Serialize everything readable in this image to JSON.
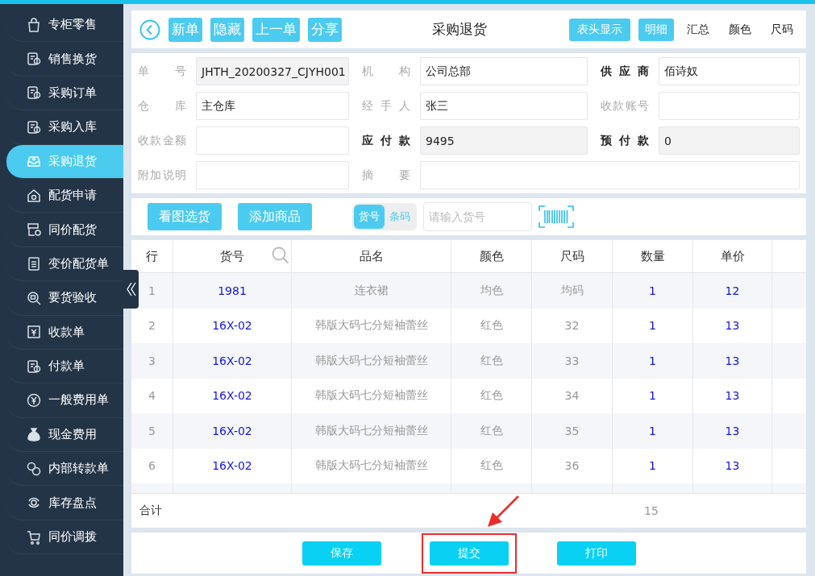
{
  "sidebar": {
    "items": [
      {
        "label": "专柜零售",
        "selected": false
      },
      {
        "label": "销售换货",
        "selected": false
      },
      {
        "label": "采购订单",
        "selected": false
      },
      {
        "label": "采购入库",
        "selected": false
      },
      {
        "label": "采购退货",
        "selected": true
      },
      {
        "label": "配货申请",
        "selected": false
      },
      {
        "label": "同价配货",
        "selected": false
      },
      {
        "label": "变价配货单",
        "selected": false
      },
      {
        "label": "要货验收",
        "selected": false
      },
      {
        "label": "收款单",
        "selected": false
      },
      {
        "label": "付款单",
        "selected": false
      },
      {
        "label": "一般费用单",
        "selected": false
      },
      {
        "label": "现金费用",
        "selected": false
      },
      {
        "label": "内部转款单",
        "selected": false
      },
      {
        "label": "库存盘点",
        "selected": false
      },
      {
        "label": "同价调拨",
        "selected": false
      }
    ]
  },
  "header": {
    "title": "采购退货",
    "actions": [
      "新单",
      "隐藏",
      "上一单",
      "分享"
    ],
    "header_button": "表头显示",
    "views": [
      {
        "label": "明细",
        "selected": true
      },
      {
        "label": "汇总",
        "selected": false
      },
      {
        "label": "颜色",
        "selected": false
      },
      {
        "label": "尺码",
        "selected": false
      }
    ]
  },
  "form": {
    "fields": [
      {
        "label": "单号",
        "value": "JHTH_20200327_CJYH001",
        "bold": false,
        "readonly": true,
        "wide": false
      },
      {
        "label": "机构",
        "value": "公司总部",
        "bold": false,
        "readonly": false,
        "wide": false
      },
      {
        "label": "供应商",
        "value": "佰诗奴",
        "bold": true,
        "readonly": false,
        "wide": false
      },
      {
        "label": "仓库",
        "value": "主仓库",
        "bold": false,
        "readonly": false,
        "wide": false
      },
      {
        "label": "经手人",
        "value": "张三",
        "bold": false,
        "readonly": false,
        "wide": false
      },
      {
        "label": "收款账号",
        "bold": false,
        "readonly": false,
        "wide": false
      },
      {
        "label": "收款金额",
        "bold": false,
        "readonly": false,
        "wide": false
      },
      {
        "label": "应付款",
        "value": "9495",
        "bold": true,
        "readonly": true,
        "wide": false
      },
      {
        "label": "预付款",
        "value": "0",
        "bold": true,
        "readonly": true,
        "wide": false
      },
      {
        "label": "附加说明",
        "bold": false,
        "readonly": false,
        "wide": false
      },
      {
        "label": "摘要",
        "bold": false,
        "readonly": false,
        "wide": true
      }
    ]
  },
  "toolbar": {
    "buttons": [
      "看图选货",
      "添加商品"
    ],
    "mode": [
      {
        "label": "货号",
        "selected": true
      },
      {
        "label": "条码",
        "selected": false
      }
    ],
    "search": {
      "placeholder": "请输入货号"
    }
  },
  "table": {
    "columns": [
      "行",
      "货号",
      "品名",
      "颜色",
      "尺码",
      "数量",
      "单价"
    ],
    "rows": [
      {
        "row": "1",
        "code": "1981",
        "name": "连衣裙",
        "color_name": "均色",
        "size": "均码",
        "qty": "1",
        "price": "12"
      },
      {
        "row": "2",
        "code": "16X-02",
        "name": "韩版大码七分短袖蕾丝",
        "color_name": "红色",
        "size": "32",
        "qty": "1",
        "price": "13"
      },
      {
        "row": "3",
        "code": "16X-02",
        "name": "韩版大码七分短袖蕾丝",
        "color_name": "红色",
        "size": "33",
        "qty": "1",
        "price": "13"
      },
      {
        "row": "4",
        "code": "16X-02",
        "name": "韩版大码七分短袖蕾丝",
        "color_name": "红色",
        "size": "34",
        "qty": "1",
        "price": "13"
      },
      {
        "row": "5",
        "code": "16X-02",
        "name": "韩版大码七分短袖蕾丝",
        "color_name": "红色",
        "size": "35",
        "qty": "1",
        "price": "13"
      },
      {
        "row": "6",
        "code": "16X-02",
        "name": "韩版大码七分短袖蕾丝",
        "color_name": "红色",
        "size": "36",
        "qty": "1",
        "price": "13"
      }
    ],
    "total": {
      "label": "合计",
      "qty": "15"
    }
  },
  "footer": {
    "buttons": [
      {
        "label": "保存",
        "highlighted": false
      },
      {
        "label": "提交",
        "highlighted": true
      },
      {
        "label": "打印",
        "highlighted": false
      }
    ]
  }
}
